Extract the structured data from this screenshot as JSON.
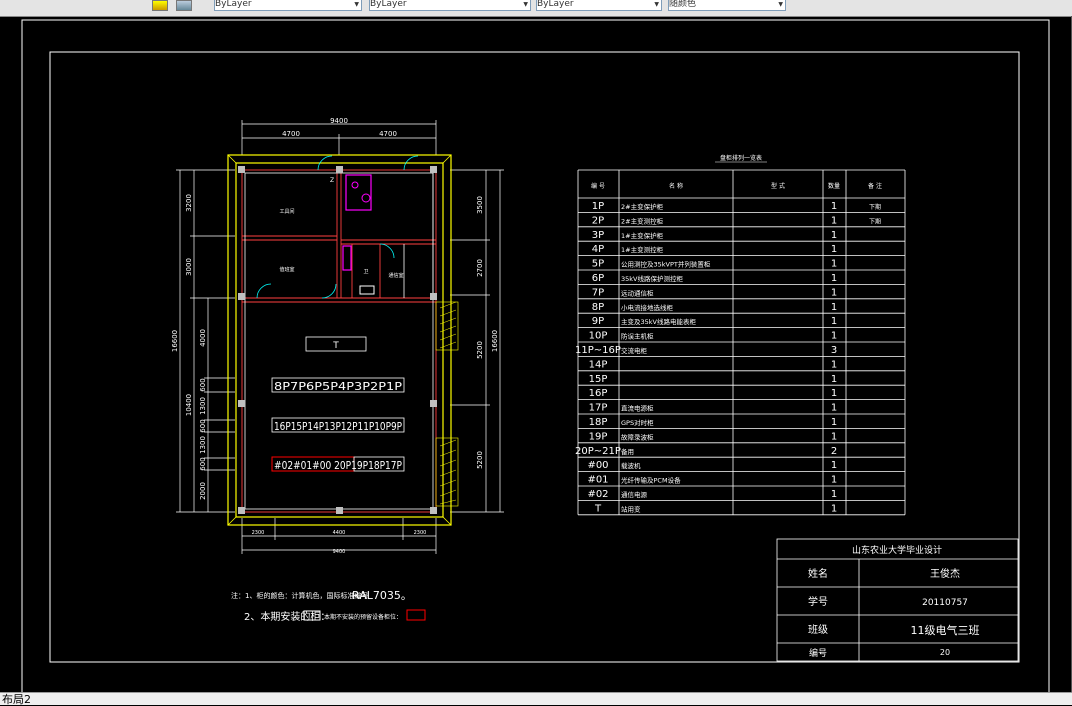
{
  "toolbar": {
    "layer_combo_1": "ByLayer",
    "layer_combo_2": "ByLayer",
    "layer_combo_3": "ByLayer",
    "plotstyle_combo": "随颜色"
  },
  "status": {
    "layout_tab": "布局2"
  },
  "plan": {
    "dims_top": [
      "9400",
      "4700",
      "4700"
    ],
    "dims_left_outer": [
      "3200",
      "3000",
      "16600"
    ],
    "dims_left_inner": [
      "4000",
      "600",
      "1300",
      "10400",
      "600",
      "1300",
      "600",
      "2000"
    ],
    "dims_right": [
      "3500",
      "2700",
      "16600",
      "5200",
      "5200"
    ],
    "dims_bottom": [
      "2300",
      "4400",
      "2300",
      "9400"
    ],
    "rooms": {
      "tools": "工具间",
      "duty": "值班室",
      "wc": "卫",
      "comm": "通信室",
      "s": "淋浴",
      "z": "Z"
    },
    "transformer": "T",
    "row1": "8P7P6P5P4P3P2P1P",
    "row2": "16P15P14P13P12P11P10P9P",
    "row3": "#02#01#00 20P19P18P17P"
  },
  "notes": {
    "note1_prefix": "注：1、柜的颜色：计算机色，国际标准编号",
    "note1_code": "RAL7035。",
    "note2": "2、本期安装的柜：",
    "note2_mid": "本期不安装的预留设备柜位："
  },
  "schedule": {
    "title": "盘柜排列一览表",
    "headers": [
      "编 号",
      "名 称",
      "型 式",
      "数量",
      "备 注"
    ],
    "rows": [
      [
        "1P",
        "2#主变保护柜",
        "",
        "1",
        "下期"
      ],
      [
        "2P",
        "2#主变测控柜",
        "",
        "1",
        "下期"
      ],
      [
        "3P",
        "1#主变保护柜",
        "",
        "1",
        ""
      ],
      [
        "4P",
        "1#主变测控柜",
        "",
        "1",
        ""
      ],
      [
        "5P",
        "公用测控及35kVPT并列装置柜",
        "",
        "1",
        ""
      ],
      [
        "6P",
        "35kV线路保护测控柜",
        "",
        "1",
        ""
      ],
      [
        "7P",
        "远动通信柜",
        "",
        "1",
        ""
      ],
      [
        "8P",
        "小电流接地选线柜",
        "",
        "1",
        ""
      ],
      [
        "9P",
        "主变及35kV线路电能表柜",
        "",
        "1",
        ""
      ],
      [
        "10P",
        "防误主机柜",
        "",
        "1",
        ""
      ],
      [
        "11P~16P",
        "交流电柜",
        "",
        "3",
        ""
      ],
      [
        "14P",
        "",
        "",
        "1",
        ""
      ],
      [
        "15P",
        "",
        "",
        "1",
        ""
      ],
      [
        "16P",
        "",
        "",
        "1",
        ""
      ],
      [
        "17P",
        "直流电源柜",
        "",
        "1",
        ""
      ],
      [
        "18P",
        "GPS对时柜",
        "",
        "1",
        ""
      ],
      [
        "19P",
        "故障录波柜",
        "",
        "1",
        ""
      ],
      [
        "20P~21P",
        "备用",
        "",
        "2",
        ""
      ],
      [
        "#00",
        "载波机",
        "",
        "1",
        ""
      ],
      [
        "#01",
        "光纤传输及PCM设备",
        "",
        "1",
        ""
      ],
      [
        "#02",
        "通信电源",
        "",
        "1",
        ""
      ],
      [
        "T",
        "站用变",
        "",
        "1",
        ""
      ]
    ]
  },
  "titleblock": {
    "school": "山东农业大学毕业设计",
    "name_label": "姓名",
    "name": "王俊杰",
    "id_label": "学号",
    "id": "20110757",
    "class_label": "班级",
    "class": "11级电气三班",
    "no_label": "编号",
    "no": "20"
  },
  "colors": {
    "background": "#000000",
    "frame": "#ffffff",
    "wall": "#ffff00",
    "red": "#ff0000",
    "magenta": "#ff00ff",
    "cyan": "#00ffff"
  }
}
